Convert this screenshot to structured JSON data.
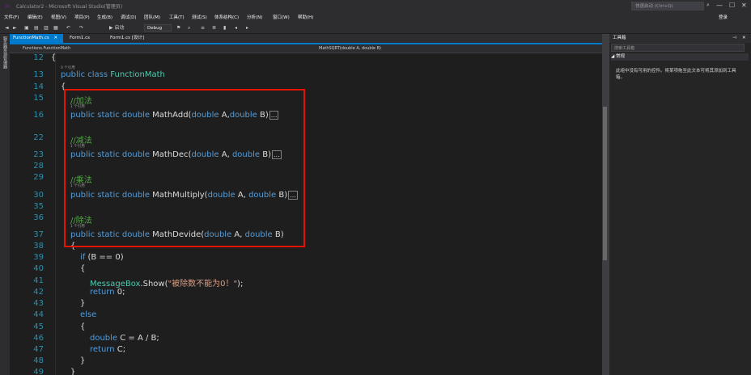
{
  "window": {
    "title": "Calculator2 - Microsoft Visual Studio(管理员)",
    "quick_launch_placeholder": "快速启动 (Ctrl+Q)",
    "minimize": "—",
    "maximize": "☐",
    "close": "✕"
  },
  "menu": [
    "文件(F)",
    "编辑(E)",
    "视图(V)",
    "项目(P)",
    "生成(B)",
    "调试(D)",
    "团队(M)",
    "工具(T)",
    "测试(S)",
    "体系结构(C)",
    "分析(N)",
    "窗口(W)",
    "帮助(H)"
  ],
  "login_label": "登录",
  "toolbar": {
    "config": "Debug",
    "start_label": "▶ 启动"
  },
  "side_tab_label": "服务器资源管理器",
  "tabs": [
    {
      "label": "FunctionMath.cs",
      "close": "✕"
    },
    {
      "label": "Form1.cs"
    },
    {
      "label": "Form1.cs [设计]"
    }
  ],
  "nav": {
    "left": "Functions.FunctionMath",
    "right": "MathSQRT(double A, double B)"
  },
  "code": {
    "lines": [
      {
        "n": "12",
        "text": "{"
      },
      {
        "n": "",
        "ref": "0 个引用"
      },
      {
        "n": "13",
        "kw": "public class ",
        "cls": "FunctionMath"
      },
      {
        "n": "14",
        "text": "{"
      },
      {
        "n": "15",
        "cm": "//加法"
      },
      {
        "n": "",
        "ref": "1 个引用"
      },
      {
        "n": "16",
        "sig": "MathAdd",
        "params": "double A,double B"
      },
      {
        "n": "22"
      },
      {
        "n": "",
        "cm2": "//减法"
      },
      {
        "n": "",
        "ref": "1 个引用"
      },
      {
        "n": "23",
        "sig": "MathDec",
        "params": "double A, double B"
      },
      {
        "n": "28"
      },
      {
        "n": "29",
        "cm": "//乘法"
      },
      {
        "n": "",
        "ref": "1 个引用"
      },
      {
        "n": "30",
        "sig": "MathMultiply",
        "params": "double A, double B"
      },
      {
        "n": "35"
      },
      {
        "n": "36",
        "cm": "//除法"
      },
      {
        "n": "",
        "ref": "1 个引用"
      },
      {
        "n": "37",
        "sig": "MathDevide",
        "params": "double A, double B"
      }
    ],
    "l12": "{",
    "ref0": "0 个引用",
    "l13_kw": "public class ",
    "l13_cls": "FunctionMath",
    "l14": "{",
    "c_add": "//加法",
    "c_dec": "//减法",
    "c_mul": "//乘法",
    "c_div": "//除法",
    "ref1": "1 个引用",
    "sig_prefix": "public static double ",
    "add_name": "MathAdd(",
    "add_params_kw1": "double",
    "add_params_a": " A,",
    "add_params_kw2": "double",
    "add_params_b": " B)",
    "dec_name": "MathDec(",
    "dec_kw1": "double",
    "dec_a": " A, ",
    "dec_kw2": "double",
    "dec_b": " B)",
    "mul_name": "MathMultiply(",
    "mul_kw1": "double",
    "mul_a": " A, ",
    "mul_kw2": "double",
    "mul_b": " B)",
    "div_name": "MathDevide(",
    "div_kw1": "double",
    "div_a": " A, ",
    "div_kw2": "double",
    "div_b": " B)",
    "collapsed": "...",
    "l38": "{",
    "l39_kw": "if",
    "l39_rest": " (B == 0)",
    "l40": "{",
    "l41_cls": "MessageBox",
    "l41_mid": ".Show(",
    "l41_str": "\"被除数不能为0！\"",
    "l41_end": ");",
    "l42_kw": "return",
    "l42_rest": " 0;",
    "l43": "}",
    "l44_kw": "else",
    "l45": "{",
    "l46_kw": "double",
    "l46_rest": " C = A / B;",
    "l47_kw": "return",
    "l47_rest": " C;",
    "l48": "}",
    "l49": "}"
  },
  "line_numbers": [
    "12",
    "13",
    "14",
    "15",
    "16",
    "22",
    "23",
    "28",
    "29",
    "30",
    "35",
    "36",
    "37",
    "38",
    "39",
    "40",
    "41",
    "42",
    "43",
    "44",
    "45",
    "46",
    "47",
    "48",
    "49"
  ],
  "toolbox": {
    "title": "工具箱",
    "search_placeholder": "搜索工具箱",
    "group": "◢ 常规",
    "empty_text": "此组中没有可用的控件。将某项拖至此文本可将其添加到工具箱。"
  },
  "colors": {
    "accent": "#007acc",
    "highlight_box": "#e51400",
    "keyword": "#569cd6",
    "type": "#4ec9b0",
    "comment": "#57a64a",
    "string": "#d69d85"
  }
}
